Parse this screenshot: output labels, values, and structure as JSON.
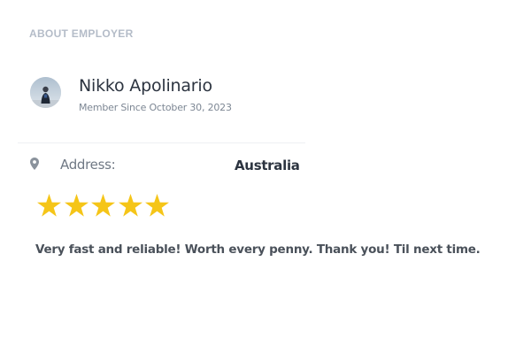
{
  "employer": {
    "section_title": "ABOUT EMPLOYER",
    "name": "Nikko Apolinario",
    "member_since": "Member Since October 30, 2023",
    "avatar": "user-avatar-photo",
    "address_label": "Address:",
    "address_value": "Australia",
    "address_icon": "map-pin-icon"
  },
  "review": {
    "rating": 5,
    "max_rating": 5,
    "star_color": "#f5c518",
    "text": "Very fast and reliable! Worth every penny. Thank you! Til next time."
  }
}
